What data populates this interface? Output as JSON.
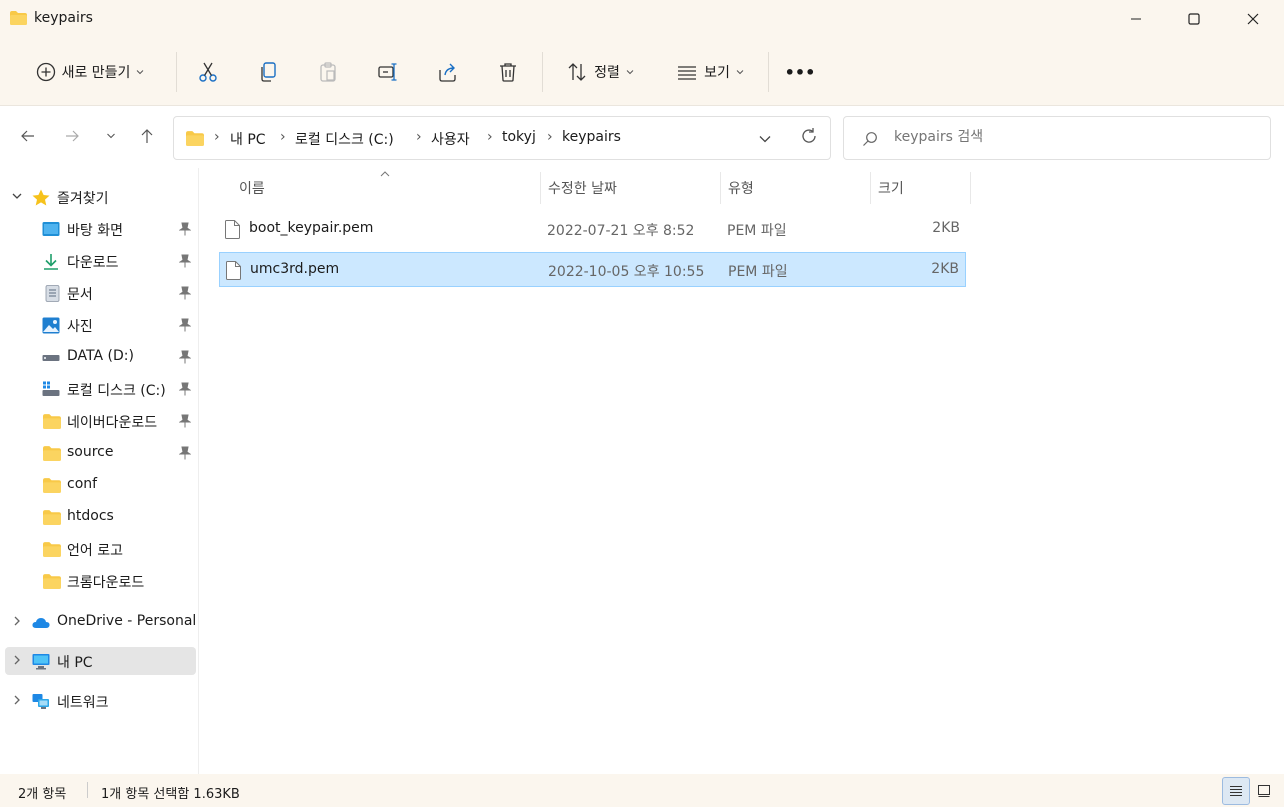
{
  "window": {
    "title": "keypairs"
  },
  "toolbar": {
    "new_label": "새로 만들기",
    "sort_label": "정렬",
    "view_label": "보기",
    "more_label": "•••"
  },
  "address": {
    "crumbs": [
      "내 PC",
      "로컬 디스크 (C:)",
      "사용자",
      "tokyj",
      "keypairs"
    ],
    "search_placeholder": "keypairs 검색"
  },
  "sidebar": {
    "quick_access": "즐겨찾기",
    "items": [
      {
        "label": "바탕 화면",
        "icon": "desktop-icon"
      },
      {
        "label": "다운로드",
        "icon": "download-icon"
      },
      {
        "label": "문서",
        "icon": "document-icon"
      },
      {
        "label": "사진",
        "icon": "picture-icon"
      },
      {
        "label": "DATA (D:)",
        "icon": "drive-icon"
      },
      {
        "label": "로컬 디스크 (C:)",
        "icon": "system-drive-icon"
      },
      {
        "label": "네이버다운로드",
        "icon": "folder-icon"
      },
      {
        "label": "source",
        "icon": "folder-icon"
      },
      {
        "label": "conf",
        "icon": "folder-icon"
      },
      {
        "label": "htdocs",
        "icon": "folder-icon"
      },
      {
        "label": "언어 로고",
        "icon": "folder-icon"
      },
      {
        "label": "크롬다운로드",
        "icon": "folder-icon"
      }
    ],
    "onedrive": "OneDrive - Personal",
    "this_pc": "내 PC",
    "network": "네트워크"
  },
  "columns": {
    "name": "이름",
    "modified": "수정한 날짜",
    "type": "유형",
    "size": "크기"
  },
  "files": [
    {
      "name": "boot_keypair.pem",
      "modified": "2022-07-21 오후 8:52",
      "type": "PEM 파일",
      "size": "2KB",
      "selected": false
    },
    {
      "name": "umc3rd.pem",
      "modified": "2022-10-05 오후 10:55",
      "type": "PEM 파일",
      "size": "2KB",
      "selected": true
    }
  ],
  "status": {
    "count": "2개 항목",
    "selection": "1개 항목 선택함 1.63KB"
  },
  "colors": {
    "accent": "#0067c0",
    "selection_bg": "#cce8ff",
    "selection_border": "#99d1ff",
    "folder": "#f8c948",
    "chrome_bg": "#fbf6ee"
  }
}
